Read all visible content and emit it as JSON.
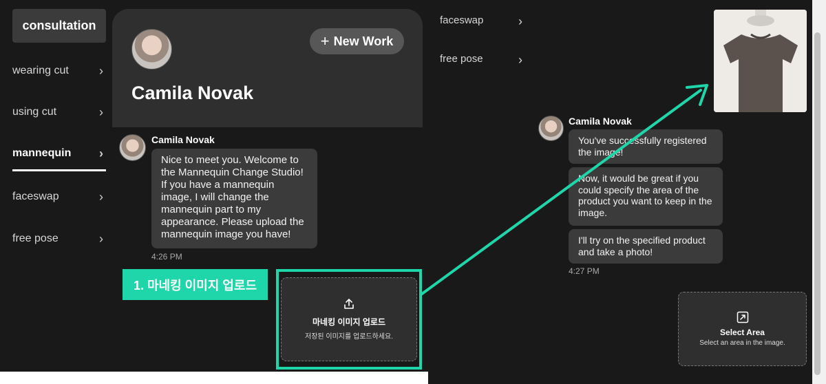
{
  "sidebar": {
    "items": [
      {
        "label": "consultation",
        "active": true
      },
      {
        "label": "wearing cut"
      },
      {
        "label": "using cut"
      },
      {
        "label": "mannequin"
      },
      {
        "label": "faceswap"
      },
      {
        "label": "free pose"
      }
    ],
    "chevron": "›"
  },
  "profile": {
    "name": "Camila Novak",
    "new_work_label": "New Work",
    "new_work_icon": "plus-icon"
  },
  "chat_left": {
    "sender": "Camila Novak",
    "message": "Nice to meet you. Welcome to the Mannequin Change Studio! If you have a mannequin image, I will change the mannequin part to my appearance. Please upload the mannequin image you have!",
    "time": "4:26 PM"
  },
  "annotation": {
    "step_label": "1. 마네킹 이미지 업로드",
    "accent_color": "#1fd6aa"
  },
  "upload": {
    "icon": "upload-icon",
    "title": "마네킹 이미지 업로드",
    "subtitle": "저장된 이미지를 업로드하세요."
  },
  "right_nav": {
    "items": [
      {
        "label": "faceswap"
      },
      {
        "label": "free pose"
      }
    ],
    "chevron": "›"
  },
  "chat_right": {
    "sender": "Camila Novak",
    "messages": [
      "You've successfully registered the image!",
      "Now, it would be great if you could specify the area of the product you want to keep in the image.",
      "I'll try on the specified product and take a photo!"
    ],
    "time": "4:27 PM"
  },
  "select_area": {
    "icon": "expand-icon",
    "title": "Select Area",
    "subtitle": "Select an area in the image."
  }
}
